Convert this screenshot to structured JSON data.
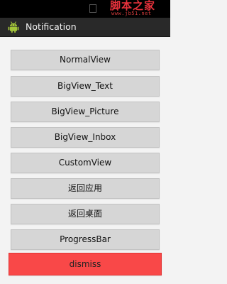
{
  "watermark": {
    "main": "脚本之家",
    "sub": "www.jb51.net",
    "color": "#e8323c"
  },
  "app": {
    "title": "Notification",
    "icon": "android-robot-icon"
  },
  "buttons": [
    "NormalView",
    "BigView_Text",
    "BigView_Picture",
    "BigView_Inbox",
    "CustomView",
    "返回应用",
    "返回桌面",
    "ProgressBar"
  ],
  "dismiss": {
    "label": "dismiss",
    "color": "#f94848"
  }
}
